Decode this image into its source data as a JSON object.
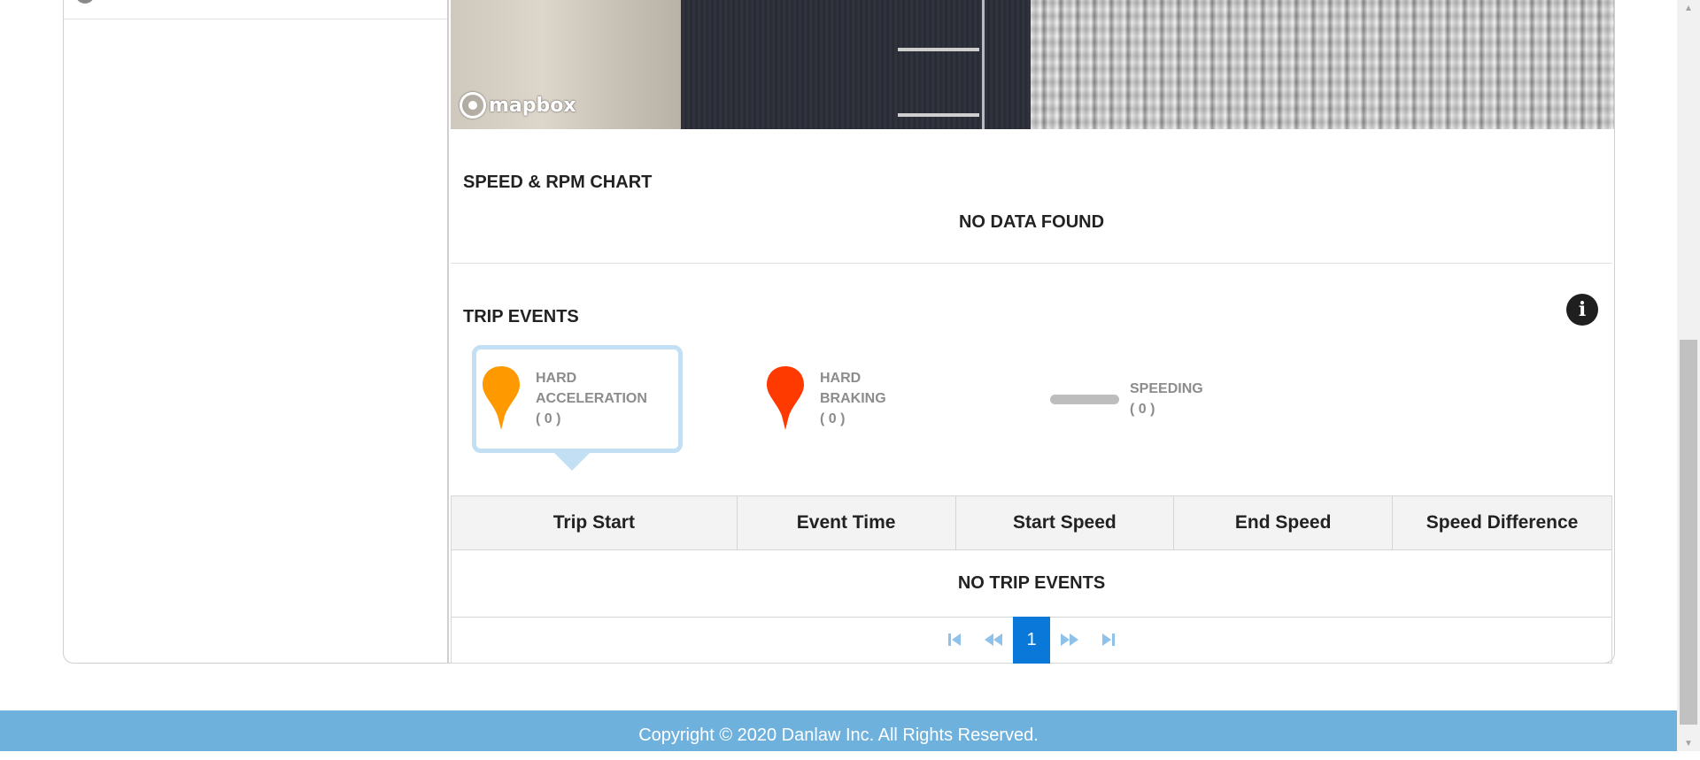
{
  "map": {
    "attribution": "mapbox"
  },
  "speed_chart": {
    "title": "SPEED & RPM CHART",
    "empty_message": "NO DATA FOUND"
  },
  "trip_events": {
    "title": "TRIP EVENTS",
    "info_icon": "info-icon",
    "legend": [
      {
        "line1": "HARD",
        "line2": "ACCELERATION",
        "count": "( 0 )",
        "color": "#ff9900",
        "selected": true
      },
      {
        "line1": "HARD",
        "line2": "BRAKING",
        "count": "( 0 )",
        "color": "#ff3a00",
        "selected": false
      },
      {
        "line1": "SPEEDING",
        "count": "( 0 )",
        "color": "#bdbdbd",
        "selected": false
      }
    ],
    "table": {
      "columns": [
        "Trip Start",
        "Event Time",
        "Start Speed",
        "End Speed",
        "Speed Difference"
      ],
      "empty_message": "NO TRIP EVENTS"
    },
    "pagination": {
      "first_icon": "first-page-icon",
      "prev_icon": "previous-page-icon",
      "current_page": "1",
      "next_icon": "next-page-icon",
      "last_icon": "last-page-icon"
    }
  },
  "footer": {
    "copyright": "Copyright © 2020 Danlaw Inc. All Rights Reserved."
  },
  "colors": {
    "accent": "#0a78d8",
    "footer_bg": "#6fb1dd",
    "selection_border": "#c3dff3"
  }
}
